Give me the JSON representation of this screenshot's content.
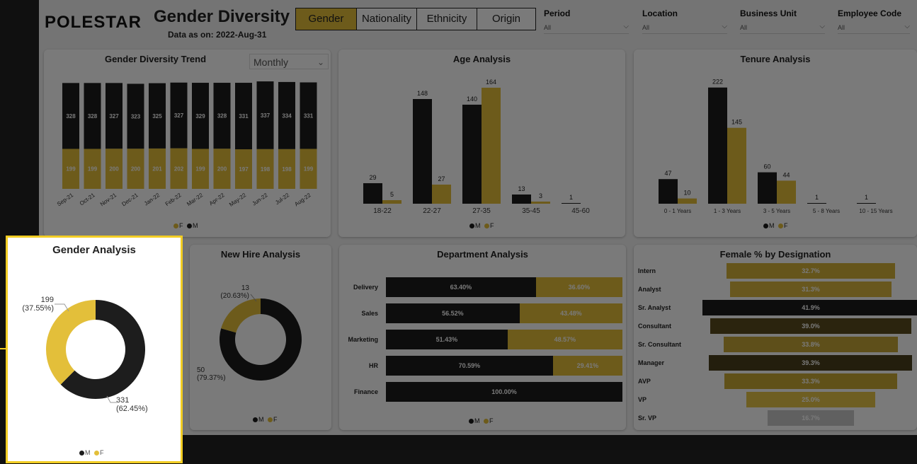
{
  "colors": {
    "male": "#1d1d1d",
    "female": "#e3bf3a",
    "focus_border": "#f2cd23"
  },
  "header": {
    "logo": "POLESTAR",
    "title": "Gender Diversity",
    "subtitle": "Data as on: 2022-Aug-31",
    "tabs": [
      {
        "label": "Gender",
        "active": true
      },
      {
        "label": "Nationality"
      },
      {
        "label": "Ethnicity"
      },
      {
        "label": "Origin"
      }
    ],
    "filters": [
      {
        "label": "Period",
        "value": "All"
      },
      {
        "label": "Location",
        "value": "All"
      },
      {
        "label": "Business Unit",
        "value": "All"
      },
      {
        "label": "Employee Code",
        "value": "All"
      }
    ]
  },
  "trend": {
    "title": "Gender Diversity Trend",
    "dropdown": "Monthly",
    "legend": [
      "F",
      "M"
    ],
    "categories": [
      "Sep-21",
      "Oct-21",
      "Nov-21",
      "Dec-21",
      "Jan-22",
      "Feb-22",
      "Mar-22",
      "Apr-22",
      "May-22",
      "Jun-22",
      "Jul-22",
      "Aug-22"
    ],
    "male": [
      328,
      328,
      327,
      323,
      325,
      327,
      329,
      328,
      331,
      337,
      334,
      331
    ],
    "female": [
      199,
      199,
      200,
      200,
      201,
      202,
      199,
      200,
      197,
      198,
      198,
      199
    ]
  },
  "age": {
    "title": "Age Analysis",
    "categories": [
      "18-22",
      "22-27",
      "27-35",
      "35-45",
      "45-60"
    ],
    "male": [
      29,
      148,
      140,
      13,
      1
    ],
    "female": [
      5,
      27,
      164,
      3,
      null
    ],
    "legend": [
      "M",
      "F"
    ]
  },
  "tenure": {
    "title": "Tenure Analysis",
    "categories": [
      "0 - 1 Years",
      "1 - 3 Years",
      "3 - 5 Years",
      "5 - 8 Years",
      "10 - 15 Years"
    ],
    "male": [
      47,
      222,
      60,
      1,
      1
    ],
    "female": [
      10,
      145,
      44,
      null,
      null
    ],
    "legend": [
      "M",
      "F"
    ]
  },
  "gender": {
    "title": "Gender Analysis",
    "female": {
      "value": "199",
      "pct": "(37.55%)",
      "share": 0.3755
    },
    "male": {
      "value": "331",
      "pct": "(62.45%)",
      "share": 0.6245
    },
    "legend": [
      "M",
      "F"
    ]
  },
  "newhire": {
    "title": "New Hire Analysis",
    "female": {
      "value": "13",
      "pct": "(20.63%)",
      "share": 0.2063
    },
    "male": {
      "value": "50",
      "pct": "(79.37%)",
      "share": 0.7937
    },
    "legend": [
      "M",
      "F"
    ]
  },
  "department": {
    "title": "Department Analysis",
    "rows": [
      {
        "name": "Delivery",
        "m_label": "63.40%",
        "m": 0.634,
        "f_label": "36.60%"
      },
      {
        "name": "Sales",
        "m_label": "56.52%",
        "m": 0.5652,
        "f_label": "43.48%"
      },
      {
        "name": "Marketing",
        "m_label": "51.43%",
        "m": 0.5143,
        "f_label": "48.57%"
      },
      {
        "name": "HR",
        "m_label": "70.59%",
        "m": 0.7059,
        "f_label": "29.41%"
      },
      {
        "name": "Finance",
        "m_label": "100.00%",
        "m": 1.0,
        "f_label": ""
      }
    ],
    "legend": [
      "M",
      "F"
    ]
  },
  "designation": {
    "title": "Female % by Designation",
    "rows": [
      {
        "name": "Intern",
        "label": "32.7%",
        "value": 32.7,
        "color": "#d4b23a"
      },
      {
        "name": "Analyst",
        "label": "31.3%",
        "value": 31.3,
        "color": "#d9b740"
      },
      {
        "name": "Sr. Analyst",
        "label": "41.9%",
        "value": 41.9,
        "color": "#1d1d1d"
      },
      {
        "name": "Consultant",
        "label": "39.0%",
        "value": 39.0,
        "color": "#5a4c1f"
      },
      {
        "name": "Sr. Consultant",
        "label": "33.8%",
        "value": 33.8,
        "color": "#c4a537"
      },
      {
        "name": "Manager",
        "label": "39.3%",
        "value": 39.3,
        "color": "#4a401c"
      },
      {
        "name": "AVP",
        "label": "33.3%",
        "value": 33.3,
        "color": "#c9a935"
      },
      {
        "name": "VP",
        "label": "25.0%",
        "value": 25.0,
        "color": "#e6c548"
      },
      {
        "name": "Sr. VP",
        "label": "16.7%",
        "value": 16.7,
        "color": "#c8c8c8"
      }
    ]
  }
}
